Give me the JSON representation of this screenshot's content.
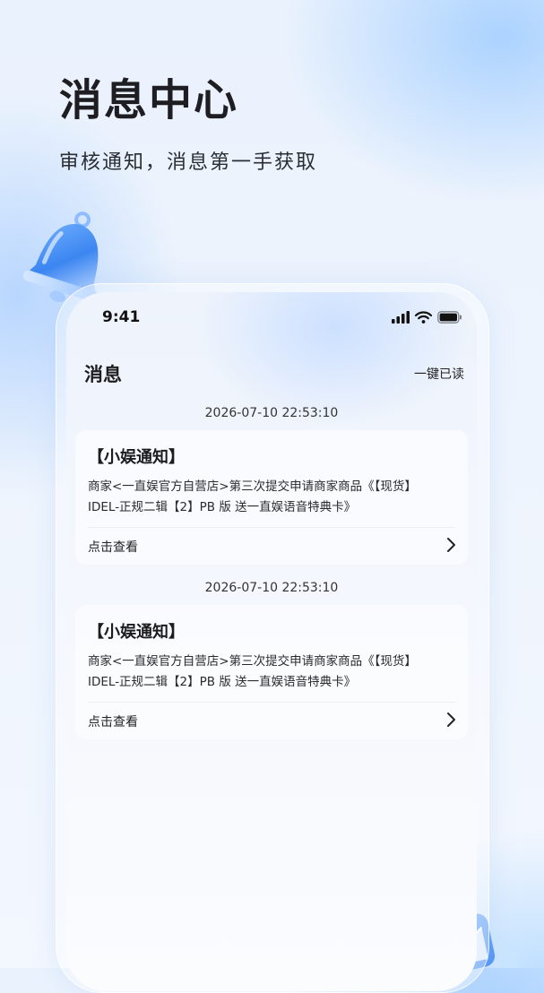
{
  "hero": {
    "title": "消息中心",
    "subtitle": "审核通知，消息第一手获取"
  },
  "status_bar": {
    "time": "9:41",
    "icons": [
      "cellular-signal-icon",
      "wifi-icon",
      "battery-icon"
    ]
  },
  "header": {
    "title": "消息",
    "mark_all_read": "一键已读"
  },
  "messages": [
    {
      "timestamp": "2026-07-10   22:53:10",
      "title": "【小娱通知】",
      "body_line1": "商家<一直娱官方自营店>第三次提交申请商家商品《【现货】",
      "body_line2": "IDEL-正规二辑【2】PB 版 送一直娱语音特典卡》",
      "action": "点击查看"
    },
    {
      "timestamp": "2026-07-10   22:53:10",
      "title": "【小娱通知】",
      "body_line1": "商家<一直娱官方自营店>第三次提交申请商家商品《【现货】",
      "body_line2": "IDEL-正规二辑【2】PB 版 送一直娱语音特典卡》",
      "action": "点击查看"
    }
  ],
  "colors": {
    "background": "#eef4fd",
    "accent_blue": "#4d8ef5",
    "text_primary": "#1e1e22"
  }
}
